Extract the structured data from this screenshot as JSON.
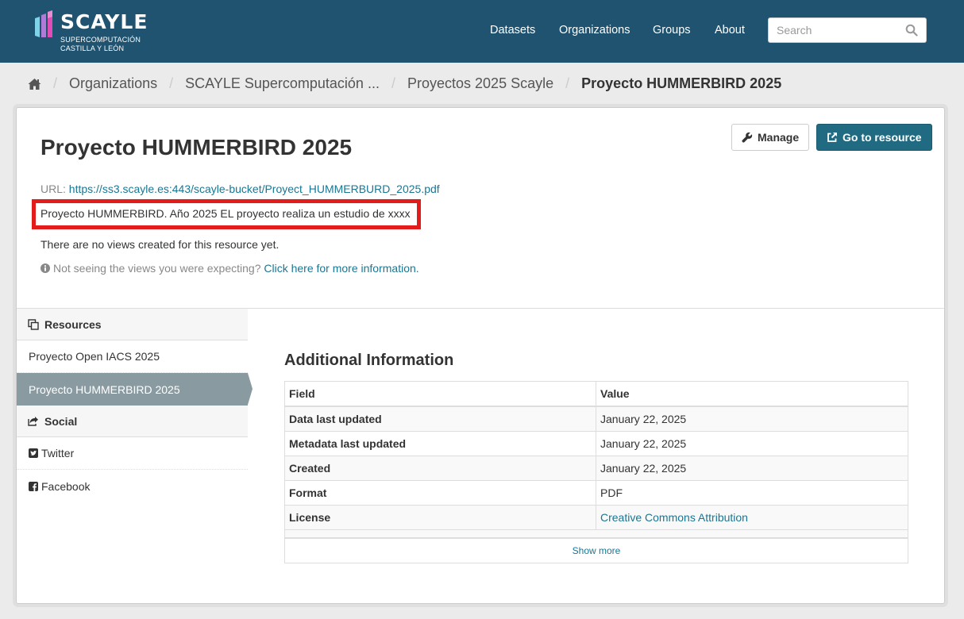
{
  "header": {
    "logo_word": "SCAYLE",
    "logo_sub_line1": "SUPERCOMPUTACIÓN",
    "logo_sub_line2": "CASTILLA Y LEÓN",
    "nav": [
      "Datasets",
      "Organizations",
      "Groups",
      "About"
    ],
    "search_placeholder": "Search"
  },
  "breadcrumb": {
    "home_icon": "home-icon",
    "items": [
      "Organizations",
      "SCAYLE Supercomputación ...",
      "Proyectos 2025 Scayle"
    ],
    "active": "Proyecto HUMMERBIRD 2025"
  },
  "resource": {
    "title": "Proyecto HUMMERBIRD 2025",
    "url_label": "URL:",
    "url": "https://ss3.scayle.es:443/scayle-bucket/Proyect_HUMMERBURD_2025.pdf",
    "description": "Proyecto HUMMERBIRD. Año 2025 EL proyecto realiza un estudio de xxxx",
    "no_views": "There are no views created for this resource yet.",
    "views_help_text": "Not seeing the views you were expecting?",
    "views_help_link": "Click here for more information."
  },
  "actions": {
    "manage": "Manage",
    "go_to_resource": "Go to resource"
  },
  "sidebar": {
    "resources_heading": "Resources",
    "resources": [
      "Proyecto Open IACS 2025",
      "Proyecto HUMMERBIRD 2025"
    ],
    "social_heading": "Social",
    "social": [
      "Twitter",
      "Facebook"
    ]
  },
  "additional_info": {
    "title": "Additional Information",
    "columns": [
      "Field",
      "Value"
    ],
    "rows": [
      {
        "field": "Data last updated",
        "value": "January 22, 2025"
      },
      {
        "field": "Metadata last updated",
        "value": "January 22, 2025"
      },
      {
        "field": "Created",
        "value": "January 22, 2025"
      },
      {
        "field": "Format",
        "value": "PDF"
      },
      {
        "field": "License",
        "value": "Creative Commons Attribution"
      }
    ],
    "show_more": "Show more"
  },
  "colors": {
    "header_bg": "#1f5370",
    "link": "#187794",
    "primary_button": "#206b82",
    "active_sidebar": "#8a9aa1",
    "highlight_box": "#e21b1b"
  }
}
